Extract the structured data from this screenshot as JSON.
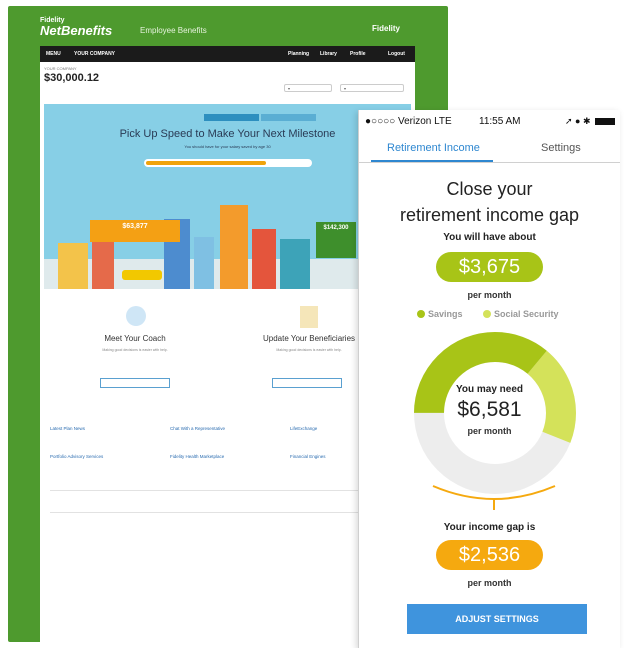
{
  "desktop": {
    "brand": "NetBenefits",
    "brand_top": "Fidelity",
    "brand_sub": "Employee Benefits",
    "logo": "Fidelity",
    "nav": [
      "MENU",
      "YOUR COMPANY",
      "Planning",
      "Library",
      "Profile",
      "Logout"
    ],
    "account_label": "YOUR COMPANY",
    "account_value": "$30,000.12",
    "hero_title": "Pick Up Speed to Make Your Next Milestone",
    "hero_sub": "You should have for your salary saved by age 30",
    "orange_value": "$63,877",
    "green_value": "$142,300",
    "card1_title": "Meet Your Coach",
    "card2_title": "Update Your Beneficiaries",
    "card_text": "Making good decisions is easier with help.",
    "link_titles": [
      "Latest Plan News",
      "Chat With a Representative",
      "LifeExchange",
      "Portfolio Advisory Services",
      "Fidelity Health Marketplace",
      "Financial Engines"
    ]
  },
  "phone": {
    "status": {
      "carrier": "●○○○○ Verizon  LTE",
      "time": "11:55 AM"
    },
    "tabs": [
      "Retirement Income",
      "Settings"
    ],
    "title_line1": "Close your",
    "title_line2": "retirement income gap",
    "have_label": "You will have about",
    "have_value": "$3,675",
    "per_month": "per month",
    "legend": [
      "Savings",
      "Social Security"
    ],
    "need_label": "You may need",
    "need_value": "$6,581",
    "need_unit": "per month",
    "gap_label": "Your income gap is",
    "gap_value": "$2,536",
    "gap_unit": "per month",
    "button": "ADJUST SETTINGS",
    "donut": {
      "savings_fraction": 0.36,
      "social_security_fraction": 0.2,
      "gap_fraction": 0.44
    },
    "colors": {
      "savings": "#a8c417",
      "social_security": "#d4e25a",
      "gap": "#ededed",
      "gap_pill": "#f5a90f",
      "accent": "#2e87d0"
    }
  }
}
